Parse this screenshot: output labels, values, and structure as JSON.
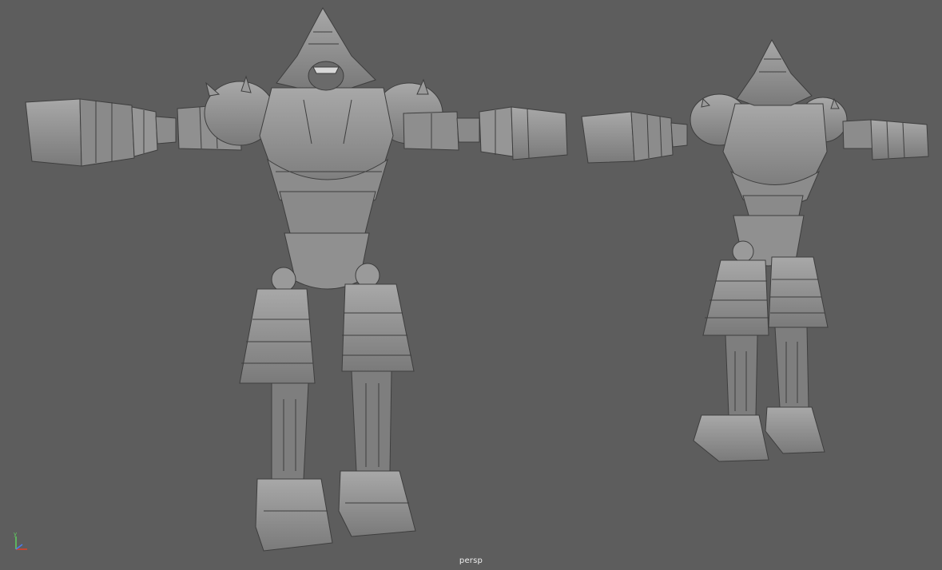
{
  "viewport": {
    "camera_label": "persp",
    "background_color": "#5d5d5d",
    "model_color": "#8f8f8f"
  },
  "axis_gizmo": {
    "y_label": "y",
    "x_color": "#e0402a",
    "y_color": "#5fd05f",
    "z_color": "#4a7cf0"
  },
  "objects": [
    {
      "name": "robot-front-view",
      "icon": "robot-model"
    },
    {
      "name": "robot-perspective-view",
      "icon": "robot-model"
    }
  ]
}
